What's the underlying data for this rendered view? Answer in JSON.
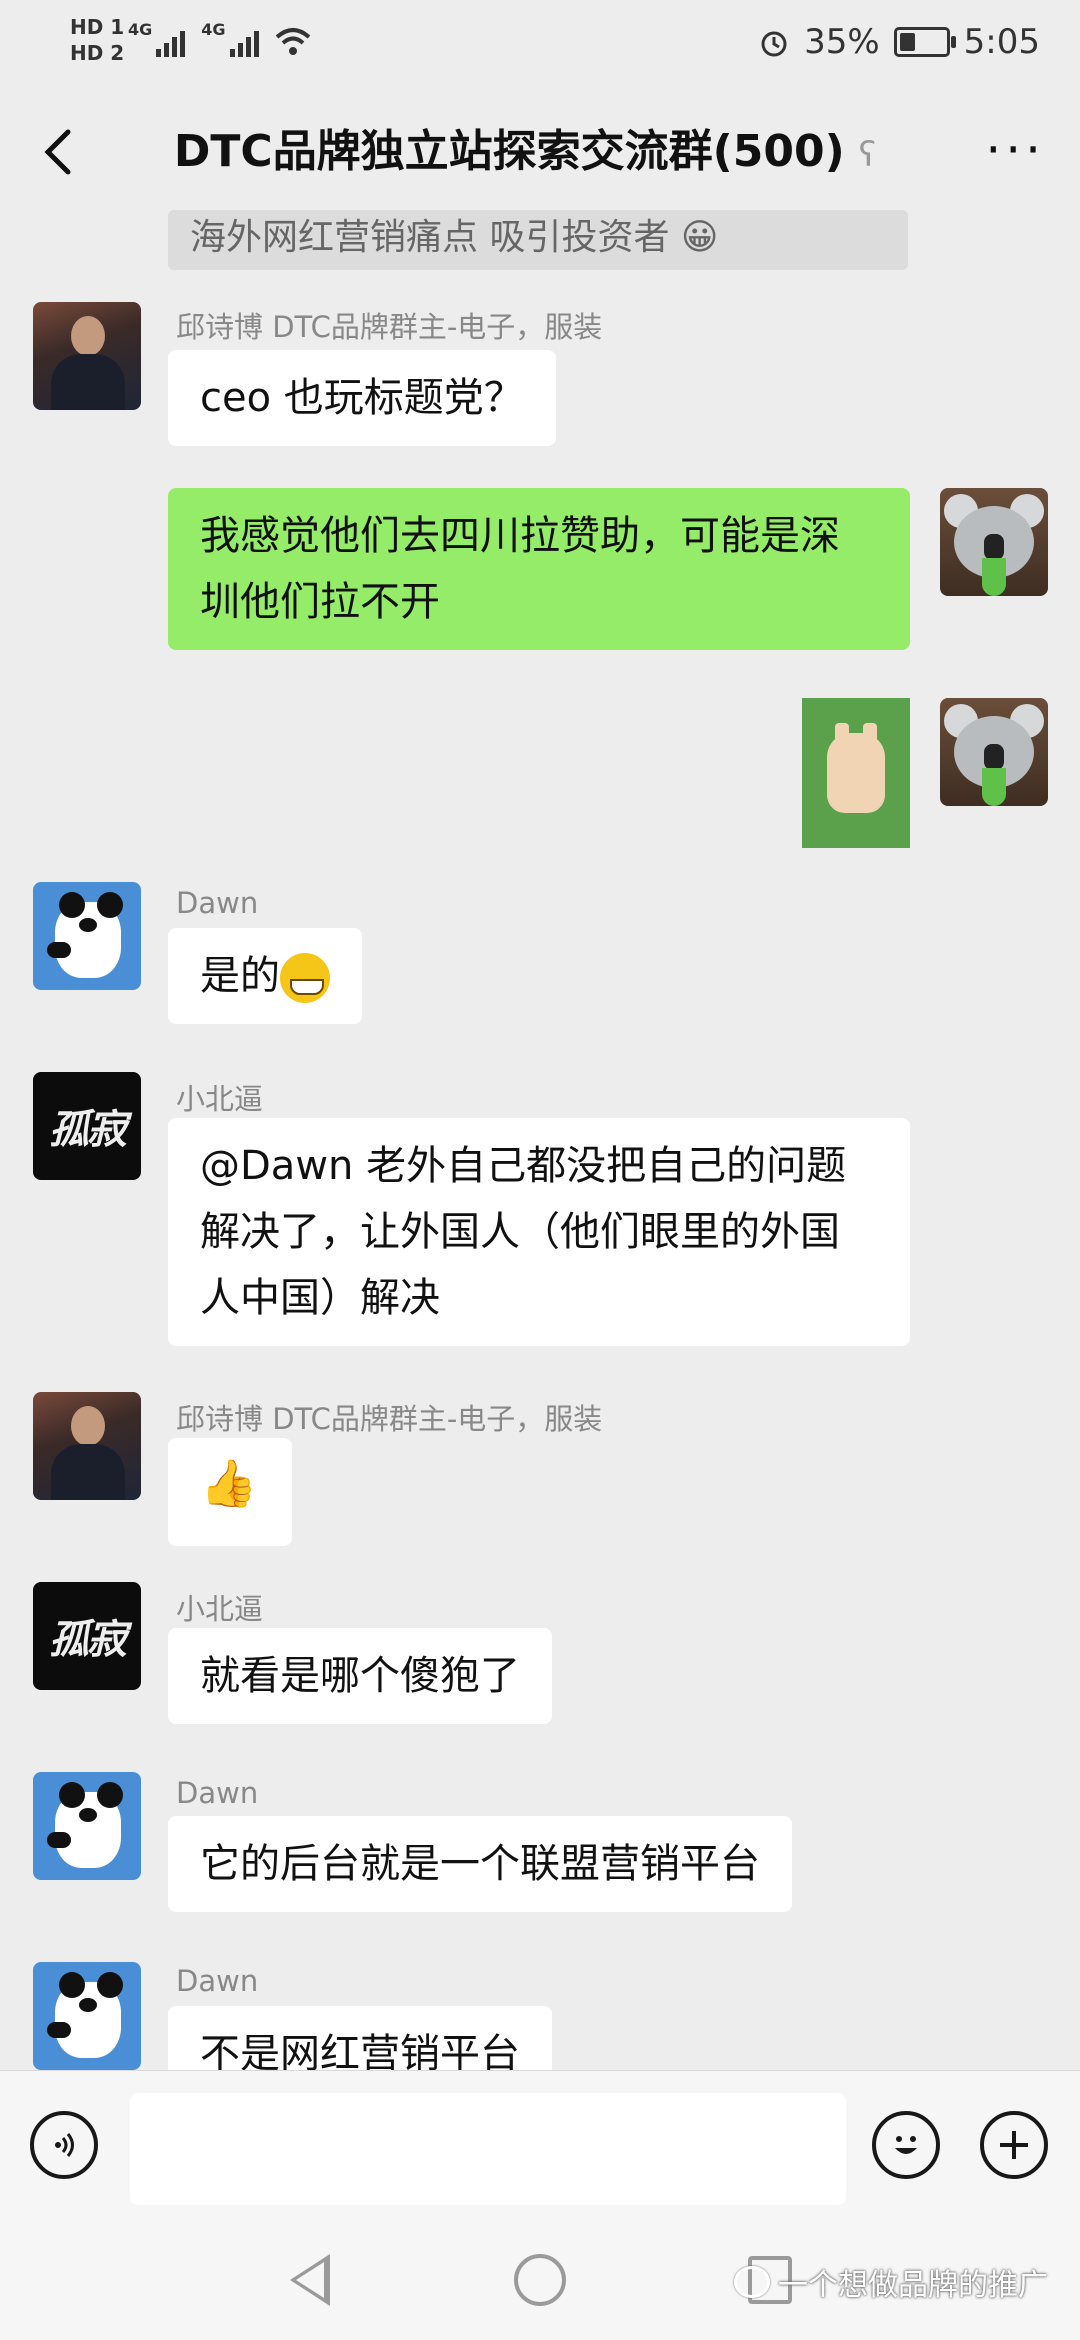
{
  "status_bar": {
    "hd1": "HD 1",
    "hd2": "HD 2",
    "net1": "4G",
    "net2": "4G",
    "battery": "35%",
    "battery_level": 0.35,
    "time": "5:05"
  },
  "header": {
    "title": "DTC品牌独立站探索交流群(500)",
    "back_icon": "chevron-left-icon",
    "ear_icon": "earpiece-icon",
    "more_icon": "more-dots-icon"
  },
  "quoted_message": {
    "text": "海外网红营销痛点 吸引投资者 😀"
  },
  "messages": [
    {
      "sender": "邱诗博 DTC品牌群主-电子，服装",
      "text": "ceo 也玩标题党？"
    },
    {
      "sender": "",
      "text": "我感觉他们去四川拉赞助，可能是深圳他们拉不开"
    },
    {
      "sender": "Dawn",
      "text": "是的"
    },
    {
      "sender": "小北逼",
      "text": "@Dawn  老外自己都没把自己的问题解决了，让外国人（他们眼里的外国人中国）解决"
    },
    {
      "sender": "邱诗博 DTC品牌群主-电子，服装",
      "text": "👍"
    },
    {
      "sender": "小北逼",
      "text": "就看是哪个傻狍了"
    },
    {
      "sender": "Dawn",
      "text": "它的后台就是一个联盟营销平台"
    },
    {
      "sender": "Dawn",
      "text": "不是网红营销平台"
    }
  ],
  "avatar_glyph": "孤寂",
  "input_bar": {
    "voice_icon": "voice-icon",
    "emoji_icon": "emoji-icon",
    "plus_icon": "plus-icon"
  },
  "watermark": {
    "text": "一个想做品牌的推广"
  }
}
